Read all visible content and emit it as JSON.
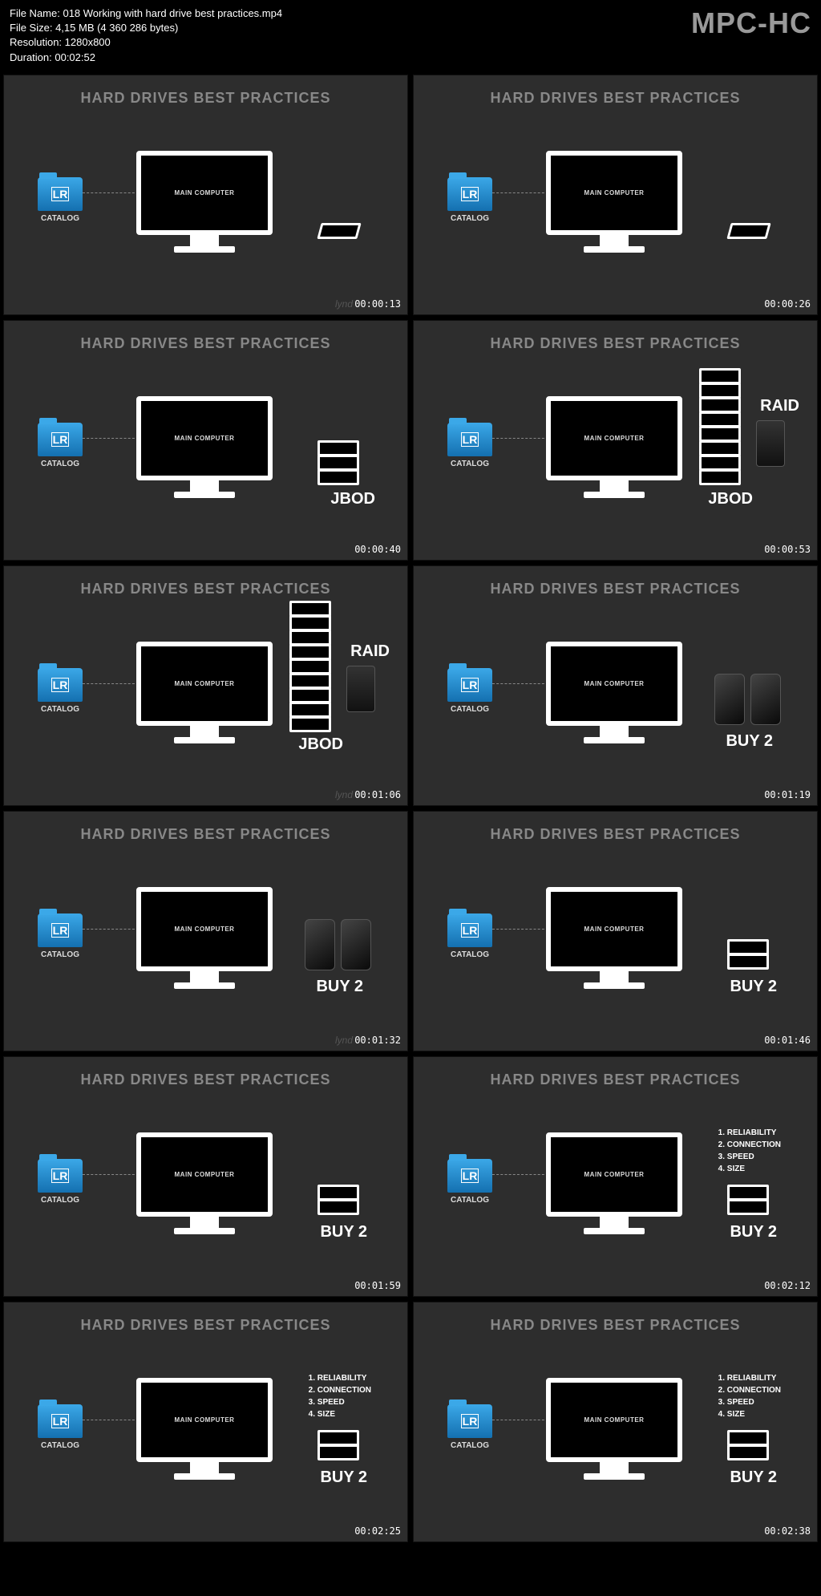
{
  "meta": {
    "filename_label": "File Name: 018 Working with hard drive best practices.mp4",
    "filesize_label": "File Size: 4,15 MB (4 360 286 bytes)",
    "resolution_label": "Resolution: 1280x800",
    "duration_label": "Duration: 00:02:52"
  },
  "app_logo": "MPC-HC",
  "slide_title": "HARD DRIVES BEST PRACTICES",
  "monitor_text": "MAIN COMPUTER",
  "folder_badge": "LR",
  "folder_label": "CATALOG",
  "labels": {
    "jbod": "JBOD",
    "raid": "RAID",
    "buy2": "BUY 2"
  },
  "criteria_list": {
    "i1": "1. RELIABILITY",
    "i2": "2. CONNECTION",
    "i3": "3. SPEED",
    "i4": "4. SIZE"
  },
  "watermark": "lynd",
  "timestamps": {
    "t1": "00:00:13",
    "t2": "00:00:26",
    "t3": "00:00:40",
    "t4": "00:00:53",
    "t5": "00:01:06",
    "t6": "00:01:19",
    "t7": "00:01:32",
    "t8": "00:01:46",
    "t9": "00:01:59",
    "t10": "00:02:12",
    "t11": "00:02:25",
    "t12": "00:02:38"
  }
}
